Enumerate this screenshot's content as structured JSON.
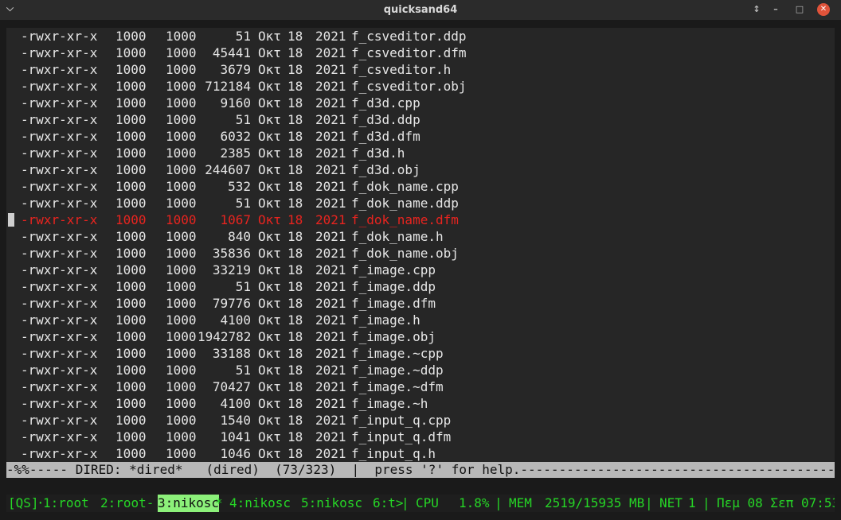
{
  "window": {
    "title": "quicksand64",
    "menu_glyph": "⌵",
    "controls": {
      "restore": "↕",
      "minimize": "–",
      "maximize": "□",
      "close": "✕"
    }
  },
  "dired": {
    "files": [
      {
        "perm": "-rwxr-xr-x",
        "uid": "1000",
        "gid": "1000",
        "size": "51",
        "month": "Οκτ",
        "day": "18",
        "year": "2021",
        "name": "f_csveditor.ddp"
      },
      {
        "perm": "-rwxr-xr-x",
        "uid": "1000",
        "gid": "1000",
        "size": "45441",
        "month": "Οκτ",
        "day": "18",
        "year": "2021",
        "name": "f_csveditor.dfm"
      },
      {
        "perm": "-rwxr-xr-x",
        "uid": "1000",
        "gid": "1000",
        "size": "3679",
        "month": "Οκτ",
        "day": "18",
        "year": "2021",
        "name": "f_csveditor.h"
      },
      {
        "perm": "-rwxr-xr-x",
        "uid": "1000",
        "gid": "1000",
        "size": "712184",
        "month": "Οκτ",
        "day": "18",
        "year": "2021",
        "name": "f_csveditor.obj"
      },
      {
        "perm": "-rwxr-xr-x",
        "uid": "1000",
        "gid": "1000",
        "size": "9160",
        "month": "Οκτ",
        "day": "18",
        "year": "2021",
        "name": "f_d3d.cpp"
      },
      {
        "perm": "-rwxr-xr-x",
        "uid": "1000",
        "gid": "1000",
        "size": "51",
        "month": "Οκτ",
        "day": "18",
        "year": "2021",
        "name": "f_d3d.ddp"
      },
      {
        "perm": "-rwxr-xr-x",
        "uid": "1000",
        "gid": "1000",
        "size": "6032",
        "month": "Οκτ",
        "day": "18",
        "year": "2021",
        "name": "f_d3d.dfm"
      },
      {
        "perm": "-rwxr-xr-x",
        "uid": "1000",
        "gid": "1000",
        "size": "2385",
        "month": "Οκτ",
        "day": "18",
        "year": "2021",
        "name": "f_d3d.h"
      },
      {
        "perm": "-rwxr-xr-x",
        "uid": "1000",
        "gid": "1000",
        "size": "244607",
        "month": "Οκτ",
        "day": "18",
        "year": "2021",
        "name": "f_d3d.obj"
      },
      {
        "perm": "-rwxr-xr-x",
        "uid": "1000",
        "gid": "1000",
        "size": "532",
        "month": "Οκτ",
        "day": "18",
        "year": "2021",
        "name": "f_dok_name.cpp"
      },
      {
        "perm": "-rwxr-xr-x",
        "uid": "1000",
        "gid": "1000",
        "size": "51",
        "month": "Οκτ",
        "day": "18",
        "year": "2021",
        "name": "f_dok_name.ddp"
      },
      {
        "perm": "-rwxr-xr-x",
        "uid": "1000",
        "gid": "1000",
        "size": "1067",
        "month": "Οκτ",
        "day": "18",
        "year": "2021",
        "name": "f_dok_name.dfm",
        "selected": true
      },
      {
        "perm": "-rwxr-xr-x",
        "uid": "1000",
        "gid": "1000",
        "size": "840",
        "month": "Οκτ",
        "day": "18",
        "year": "2021",
        "name": "f_dok_name.h"
      },
      {
        "perm": "-rwxr-xr-x",
        "uid": "1000",
        "gid": "1000",
        "size": "35836",
        "month": "Οκτ",
        "day": "18",
        "year": "2021",
        "name": "f_dok_name.obj"
      },
      {
        "perm": "-rwxr-xr-x",
        "uid": "1000",
        "gid": "1000",
        "size": "33219",
        "month": "Οκτ",
        "day": "18",
        "year": "2021",
        "name": "f_image.cpp"
      },
      {
        "perm": "-rwxr-xr-x",
        "uid": "1000",
        "gid": "1000",
        "size": "51",
        "month": "Οκτ",
        "day": "18",
        "year": "2021",
        "name": "f_image.ddp"
      },
      {
        "perm": "-rwxr-xr-x",
        "uid": "1000",
        "gid": "1000",
        "size": "79776",
        "month": "Οκτ",
        "day": "18",
        "year": "2021",
        "name": "f_image.dfm"
      },
      {
        "perm": "-rwxr-xr-x",
        "uid": "1000",
        "gid": "1000",
        "size": "4100",
        "month": "Οκτ",
        "day": "18",
        "year": "2021",
        "name": "f_image.h"
      },
      {
        "perm": "-rwxr-xr-x",
        "uid": "1000",
        "gid": "1000",
        "size": "1942782",
        "month": "Οκτ",
        "day": "18",
        "year": "2021",
        "name": "f_image.obj"
      },
      {
        "perm": "-rwxr-xr-x",
        "uid": "1000",
        "gid": "1000",
        "size": "33188",
        "month": "Οκτ",
        "day": "18",
        "year": "2021",
        "name": "f_image.~cpp"
      },
      {
        "perm": "-rwxr-xr-x",
        "uid": "1000",
        "gid": "1000",
        "size": "51",
        "month": "Οκτ",
        "day": "18",
        "year": "2021",
        "name": "f_image.~ddp"
      },
      {
        "perm": "-rwxr-xr-x",
        "uid": "1000",
        "gid": "1000",
        "size": "70427",
        "month": "Οκτ",
        "day": "18",
        "year": "2021",
        "name": "f_image.~dfm"
      },
      {
        "perm": "-rwxr-xr-x",
        "uid": "1000",
        "gid": "1000",
        "size": "4100",
        "month": "Οκτ",
        "day": "18",
        "year": "2021",
        "name": "f_image.~h"
      },
      {
        "perm": "-rwxr-xr-x",
        "uid": "1000",
        "gid": "1000",
        "size": "1540",
        "month": "Οκτ",
        "day": "18",
        "year": "2021",
        "name": "f_input_q.cpp"
      },
      {
        "perm": "-rwxr-xr-x",
        "uid": "1000",
        "gid": "1000",
        "size": "1041",
        "month": "Οκτ",
        "day": "18",
        "year": "2021",
        "name": "f_input_q.dfm"
      },
      {
        "perm": "-rwxr-xr-x",
        "uid": "1000",
        "gid": "1000",
        "size": "1046",
        "month": "Οκτ",
        "day": "18",
        "year": "2021",
        "name": "f_input_q.h"
      }
    ],
    "modeline": "-%%----- DIRED: *dired*   (dired)  (73/323)  |  press '?' for help.-------------------------------------------------"
  },
  "statusbar": {
    "session": "[QS]",
    "dot": "·",
    "windows": [
      {
        "label": "1:root",
        "active": false
      },
      {
        "label": "2:root-",
        "active": false
      },
      {
        "label": "3:nikosc",
        "active": true
      },
      {
        "label": "*",
        "active": false
      },
      {
        "label": "4:nikosc",
        "active": false
      },
      {
        "label": "5:nikosc",
        "active": false
      },
      {
        "label": "6:t>",
        "active": false
      }
    ],
    "cpu_label": "CPU",
    "cpu_value": "1.8%",
    "mem_label": "MEM",
    "mem_value": "2519/15935 MB",
    "net_label": "NET",
    "net_value": "1",
    "datetime": "Πεμ 08 Σεπ 07:53",
    "separator": "|"
  },
  "colors": {
    "selected_row": "#e8241f",
    "status_green": "#26d626",
    "active_window_bg": "#8cf07a",
    "modeline_bg": "#b8b8b8"
  }
}
